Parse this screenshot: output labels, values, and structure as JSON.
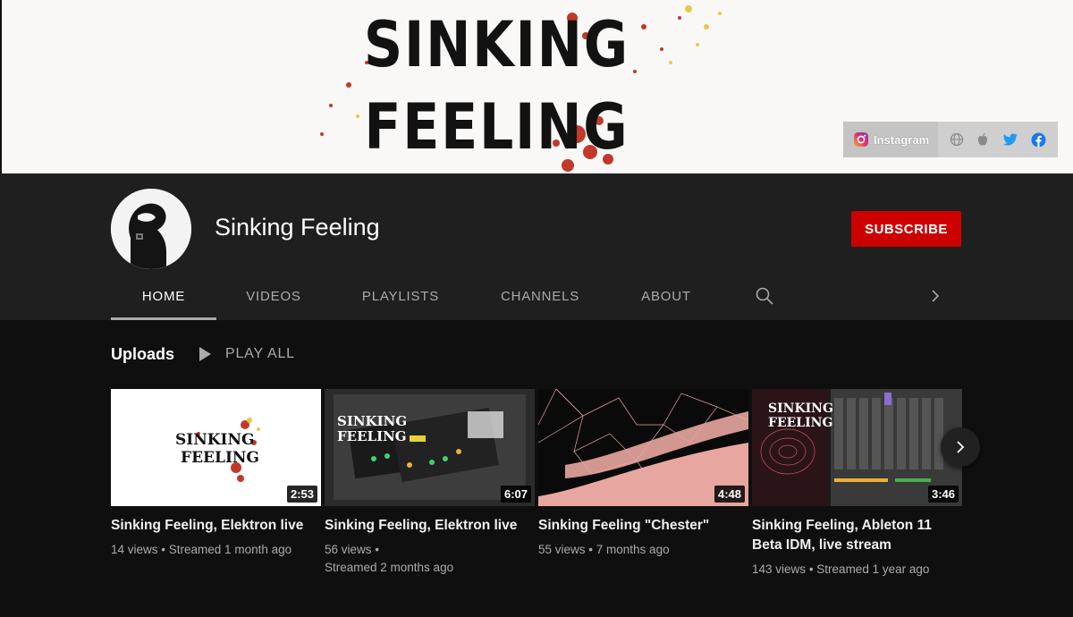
{
  "banner": {
    "title_line1": "SINKING",
    "title_line2": "FEELING",
    "instagram_label": "Instagram",
    "link_icons": [
      "globe-icon",
      "apple-icon",
      "twitter-icon",
      "facebook-icon"
    ]
  },
  "channel": {
    "name": "Sinking Feeling",
    "subscribe_label": "SUBSCRIBE"
  },
  "tabs": [
    "HOME",
    "VIDEOS",
    "PLAYLISTS",
    "CHANNELS",
    "ABOUT"
  ],
  "uploads": {
    "title": "Uploads",
    "play_all_label": "PLAY ALL",
    "videos": [
      {
        "title": "Sinking Feeling, Elektron live",
        "duration": "2:53",
        "views": "14 views",
        "age": "Streamed 1 month ago",
        "thumb_text1": "SINKING",
        "thumb_text2": "FEELING"
      },
      {
        "title": "Sinking Feeling, Elektron live",
        "duration": "6:07",
        "views": "56 views",
        "age": "Streamed 2 months ago",
        "thumb_text1": "SINKING",
        "thumb_text2": "FEELING"
      },
      {
        "title": "Sinking Feeling \"Chester\"",
        "duration": "4:48",
        "views": "55 views",
        "age": "7 months ago"
      },
      {
        "title_line1": "Sinking Feeling, Ableton 11",
        "title_line2": "Beta IDM, live stream",
        "duration": "3:46",
        "views": "143 views",
        "age": "Streamed 1 year ago",
        "thumb_text1": "SINKING",
        "thumb_text2": "FEELING"
      }
    ]
  },
  "colors": {
    "subscribe": "#cc0000",
    "background": "#0f0f0f",
    "header": "#1f1f1f",
    "muted_text": "#aaaaaa"
  }
}
